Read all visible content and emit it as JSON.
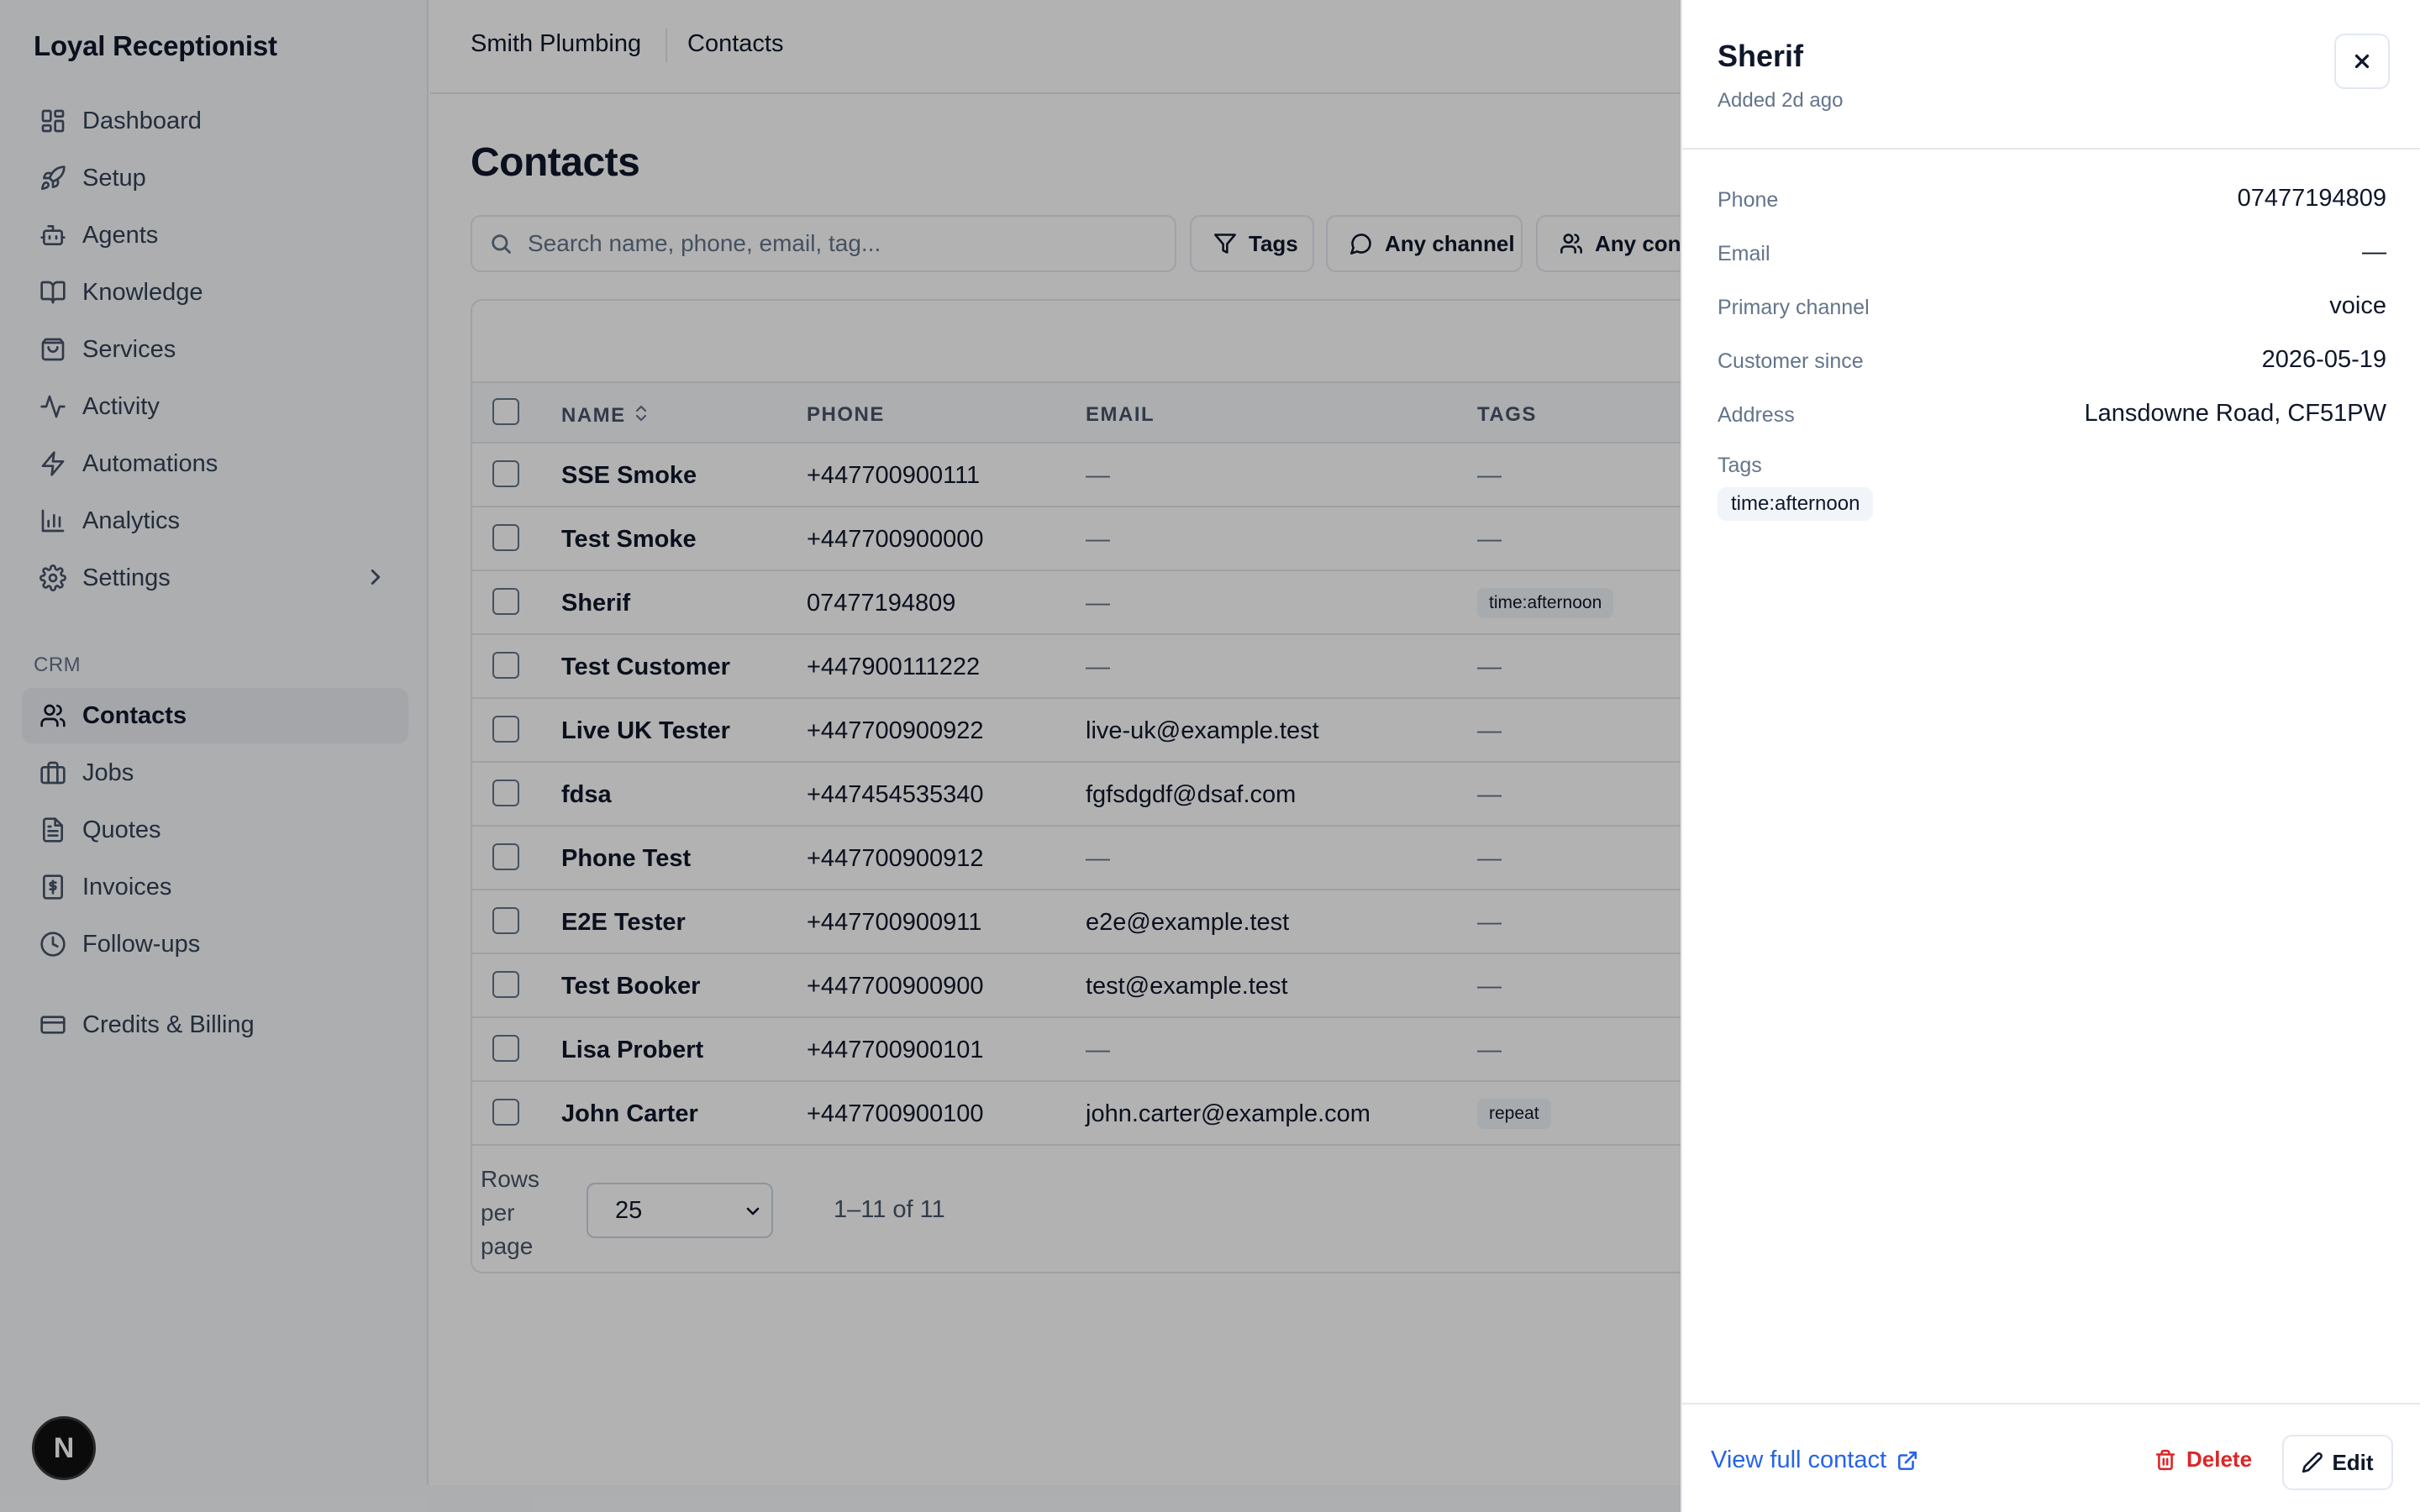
{
  "app": {
    "brand": "Loyal Receptionist"
  },
  "sidebar": {
    "items": [
      {
        "label": "Dashboard",
        "icon": "dashboard-icon"
      },
      {
        "label": "Setup",
        "icon": "rocket-icon"
      },
      {
        "label": "Agents",
        "icon": "bot-icon"
      },
      {
        "label": "Knowledge",
        "icon": "book-icon"
      },
      {
        "label": "Services",
        "icon": "shopping-bag-icon"
      },
      {
        "label": "Activity",
        "icon": "activity-icon"
      },
      {
        "label": "Automations",
        "icon": "zap-icon"
      },
      {
        "label": "Analytics",
        "icon": "bar-chart-icon"
      },
      {
        "label": "Settings",
        "icon": "gear-icon"
      }
    ],
    "crm_label": "CRM",
    "crm_items": [
      {
        "label": "Contacts",
        "icon": "users-icon",
        "active": true
      },
      {
        "label": "Jobs",
        "icon": "briefcase-icon"
      },
      {
        "label": "Quotes",
        "icon": "file-text-icon"
      },
      {
        "label": "Invoices",
        "icon": "receipt-icon"
      },
      {
        "label": "Follow-ups",
        "icon": "clock-icon"
      }
    ],
    "billing": {
      "label": "Credits & Billing",
      "icon": "credit-card-icon"
    },
    "badge": "N"
  },
  "breadcrumb": {
    "org": "Smith Plumbing",
    "page": "Contacts"
  },
  "page": {
    "title": "Contacts"
  },
  "search": {
    "placeholder": "Search name, phone, email, tag..."
  },
  "filters": {
    "tags": "Tags",
    "channel": "Any channel",
    "contact": "Any contact"
  },
  "table": {
    "columns": {
      "name": "NAME",
      "phone": "PHONE",
      "email": "EMAIL",
      "tags": "TAGS"
    },
    "rows": [
      {
        "name": "SSE Smoke",
        "phone": "+447700900111",
        "email": "—",
        "tags": "—"
      },
      {
        "name": "Test Smoke",
        "phone": "+447700900000",
        "email": "—",
        "tags": "—"
      },
      {
        "name": "Sherif",
        "phone": "07477194809",
        "email": "—",
        "tags": "time:afternoon"
      },
      {
        "name": "Test Customer",
        "phone": "+447900111222",
        "email": "—",
        "tags": "—"
      },
      {
        "name": "Live UK Tester",
        "phone": "+447700900922",
        "email": "live-uk@example.test",
        "tags": "—"
      },
      {
        "name": "fdsa",
        "phone": "+447454535340",
        "email": "fgfsdgdf@dsaf.com",
        "tags": "—"
      },
      {
        "name": "Phone Test",
        "phone": "+447700900912",
        "email": "—",
        "tags": "—"
      },
      {
        "name": "E2E Tester",
        "phone": "+447700900911",
        "email": "e2e@example.test",
        "tags": "—"
      },
      {
        "name": "Test Booker",
        "phone": "+447700900900",
        "email": "test@example.test",
        "tags": "—"
      },
      {
        "name": "Lisa Probert",
        "phone": "+447700900101",
        "email": "—",
        "tags": "—"
      },
      {
        "name": "John Carter",
        "phone": "+447700900100",
        "email": "john.carter@example.com",
        "tags": "repeat"
      }
    ]
  },
  "pager": {
    "rows_label": "Rows per page",
    "rows_value": "25",
    "range": "1–11 of 11"
  },
  "drawer": {
    "title": "Sherif",
    "subtitle": "Added 2d ago",
    "fields": [
      {
        "label": "Phone",
        "value": "07477194809"
      },
      {
        "label": "Email",
        "value": "—"
      },
      {
        "label": "Primary channel",
        "value": "voice"
      },
      {
        "label": "Customer since",
        "value": "2026-05-19"
      },
      {
        "label": "Address",
        "value": "Lansdowne Road, CF51PW"
      }
    ],
    "tags_label": "Tags",
    "tag": "time:afternoon",
    "view_link": "View full contact",
    "delete": "Delete",
    "edit": "Edit"
  },
  "colors": {
    "link": "#2563eb",
    "danger": "#dc2626",
    "overlay": "rgba(0,0,0,0.3)"
  }
}
